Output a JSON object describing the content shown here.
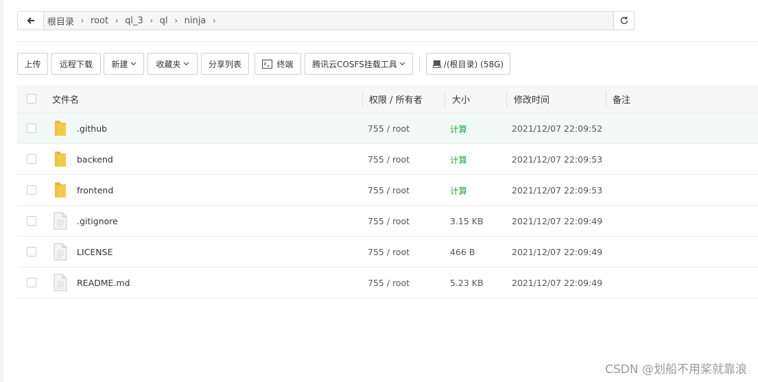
{
  "path": {
    "crumbs": [
      "根目录",
      "root",
      "ql_3",
      "ql",
      "ninja"
    ]
  },
  "toolbar": {
    "upload": "上传",
    "remote_download": "远程下载",
    "new": "新建",
    "favorites": "收藏夹",
    "share_list": "分享列表",
    "terminal": "终端",
    "cos_tool": "腾讯云COSFS挂载工具",
    "disk": "/(根目录) (58G)"
  },
  "table": {
    "headers": {
      "name": "文件名",
      "perm": "权限 / 所有者",
      "size": "大小",
      "mtime": "修改时间",
      "note": "备注"
    },
    "rows": [
      {
        "name": ".github",
        "type": "folder",
        "perm": "755 / root",
        "size": "计算",
        "mtime": "2021/12/07 22:09:52"
      },
      {
        "name": "backend",
        "type": "folder",
        "perm": "755 / root",
        "size": "计算",
        "mtime": "2021/12/07 22:09:53"
      },
      {
        "name": "frontend",
        "type": "folder",
        "perm": "755 / root",
        "size": "计算",
        "mtime": "2021/12/07 22:09:53"
      },
      {
        "name": ".gitignore",
        "type": "file",
        "perm": "755 / root",
        "size": "3.15 KB",
        "mtime": "2021/12/07 22:09:49"
      },
      {
        "name": "LICENSE",
        "type": "file",
        "perm": "755 / root",
        "size": "466 B",
        "mtime": "2021/12/07 22:09:49"
      },
      {
        "name": "README.md",
        "type": "file",
        "perm": "755 / root",
        "size": "5.23 KB",
        "mtime": "2021/12/07 22:09:49"
      }
    ]
  },
  "watermark": "CSDN @划船不用桨就靠浪",
  "colors": {
    "accent_green": "#20a53a",
    "folder_yellow": "#f7c948",
    "highlight_row": "#f1faf7"
  }
}
